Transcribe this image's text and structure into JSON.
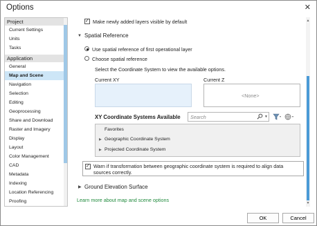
{
  "window": {
    "title": "Options",
    "close_glyph": "✕"
  },
  "sidebar": {
    "groups": [
      {
        "label": "Project",
        "items": [
          "Current Settings",
          "Units",
          "Tasks"
        ]
      },
      {
        "label": "Application",
        "items": [
          "General",
          "Map and Scene",
          "Navigation",
          "Selection",
          "Editing",
          "Geoprocessing",
          "Share and Download",
          "Raster and Imagery",
          "Display",
          "Layout",
          "Color Management",
          "CAD",
          "Metadata",
          "Indexing",
          "Location Referencing",
          "Proofing"
        ]
      }
    ],
    "selected": "Map and Scene"
  },
  "content": {
    "top_checkbox_label": "Make newly added layers visible by default",
    "spatial_section_label": "Spatial Reference",
    "radio_first": "Use spatial reference of first operational layer",
    "radio_choose": "Choose spatial reference",
    "instruction": "Select the Coordinate System to view the available options.",
    "current_xy_label": "Current XY",
    "current_z_label": "Current Z",
    "current_z_value": "<None>",
    "xy_available_label": "XY Coordinate Systems Available",
    "search_placeholder": "Search",
    "tree": {
      "favorites": "Favorites",
      "geographic": "Geographic Coordinate System",
      "projected": "Projected Coordinate System"
    },
    "warn_label": "Warn if transformation between geographic coordinate system is required to align data sources correctly.",
    "ground_section_label": "Ground Elevation Surface",
    "learn_more": "Learn more about map and scene options"
  },
  "footer": {
    "ok_label": "OK",
    "cancel_label": "Cancel"
  },
  "icons": {
    "search": "search-icon",
    "filter": "filter-icon",
    "globe": "globe-icon",
    "chevron_down": "chevron-down-icon",
    "chevron_right": "chevron-right-icon"
  },
  "colors": {
    "selected_bg": "#cde6f7",
    "scroll_thumb": "#4a9ad6",
    "link": "#1f8a3c"
  }
}
